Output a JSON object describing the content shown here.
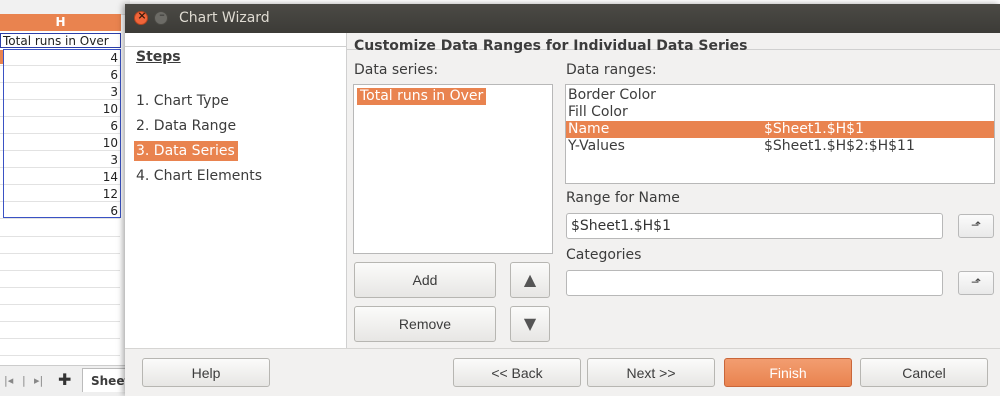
{
  "spreadsheet": {
    "column_header": "H",
    "header_cell": "Total runs in Over",
    "values": [
      "4",
      "6",
      "3",
      "10",
      "6",
      "10",
      "3",
      "14",
      "12",
      "6"
    ],
    "sheet_tab": "Sheet"
  },
  "dialog": {
    "title": "Chart Wizard",
    "steps_heading": "Steps",
    "steps": [
      "1. Chart Type",
      "2. Data Range",
      "3. Data Series",
      "4. Chart Elements"
    ],
    "active_step_index": 2,
    "content_title": "Customize Data Ranges for Individual Data Series",
    "data_series_label": "Data series:",
    "data_series": [
      "Total runs in Over"
    ],
    "data_ranges_label": "Data ranges:",
    "data_ranges": [
      {
        "role": "Border Color",
        "range": ""
      },
      {
        "role": "Fill Color",
        "range": ""
      },
      {
        "role": "Name",
        "range": "$Sheet1.$H$1"
      },
      {
        "role": "Y-Values",
        "range": "$Sheet1.$H$2:$H$11"
      }
    ],
    "selected_range_index": 2,
    "range_for_name_label": "Range for Name",
    "range_for_name_value": "$Sheet1.$H$1",
    "categories_label": "Categories",
    "categories_value": "",
    "add_label": "Add",
    "remove_label": "Remove",
    "buttons": {
      "help": "Help",
      "back": "<< Back",
      "next": "Next >>",
      "finish": "Finish",
      "cancel": "Cancel"
    }
  },
  "colors": {
    "accent": "#e9834f",
    "titlebar": "#3c3b37",
    "selection_border": "#3a52c4"
  }
}
